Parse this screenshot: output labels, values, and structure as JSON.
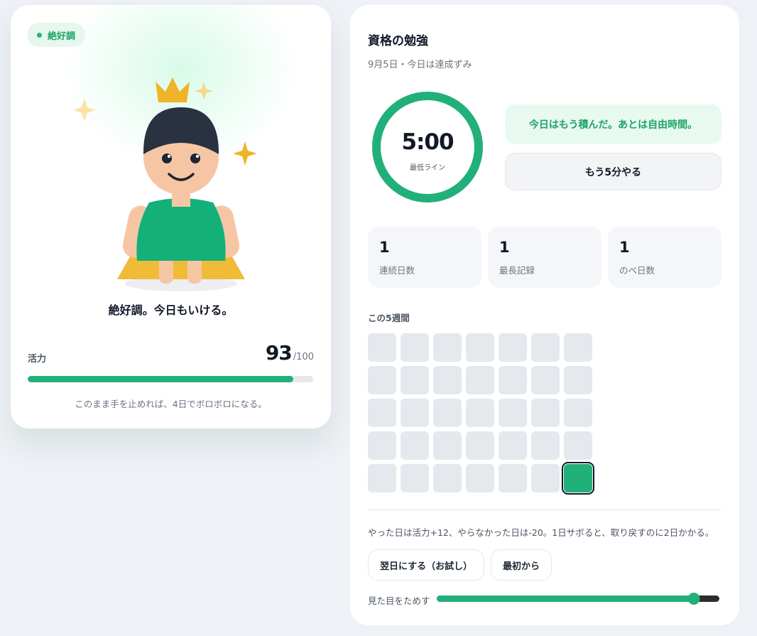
{
  "character_card": {
    "mood_badge": "絶好調",
    "caption": "絶好調。今日もいける。",
    "vitality": {
      "label": "活力",
      "value": "93",
      "max": "/100",
      "fraction": 0.93
    },
    "note": "このまま手を止めれば、4日でボロボロになる。"
  },
  "panel": {
    "title": "資格の勉強",
    "subtitle": "9月5日・今日は達成ずみ",
    "timer": {
      "time": "5:00",
      "label": "最低ライン",
      "progress": 1.0
    },
    "done_message": "今日はもう積んだ。あとは自由時間。",
    "more_button": "もう5分やる",
    "stats": [
      {
        "value": "1",
        "label": "連続日数"
      },
      {
        "value": "1",
        "label": "最長記録"
      },
      {
        "value": "1",
        "label": "のべ日数"
      }
    ],
    "weeks_title": "この5週間",
    "calendar": [
      [
        0,
        0,
        0,
        0,
        0,
        0,
        0
      ],
      [
        0,
        0,
        0,
        0,
        0,
        0,
        0
      ],
      [
        0,
        0,
        0,
        0,
        0,
        0,
        0
      ],
      [
        0,
        0,
        0,
        0,
        0,
        0,
        0
      ],
      [
        0,
        0,
        0,
        0,
        0,
        0,
        1
      ]
    ],
    "today_cell": {
      "row": 4,
      "col": 6
    },
    "rule_text": "やった日は活力+12、やらなかった日は-20。1日サボると、取り戻すのに2日かかる。",
    "buttons": {
      "next_day": "翌日にする（お試し）",
      "reset": "最初から"
    },
    "look_label": "見た目をためす",
    "look_slider": 0.91
  },
  "colors": {
    "accent": "#22b07a",
    "accent_soft": "#e8f9f0",
    "crown": "#f0b429",
    "dress": "#13b07a",
    "hair": "#2a3140"
  }
}
